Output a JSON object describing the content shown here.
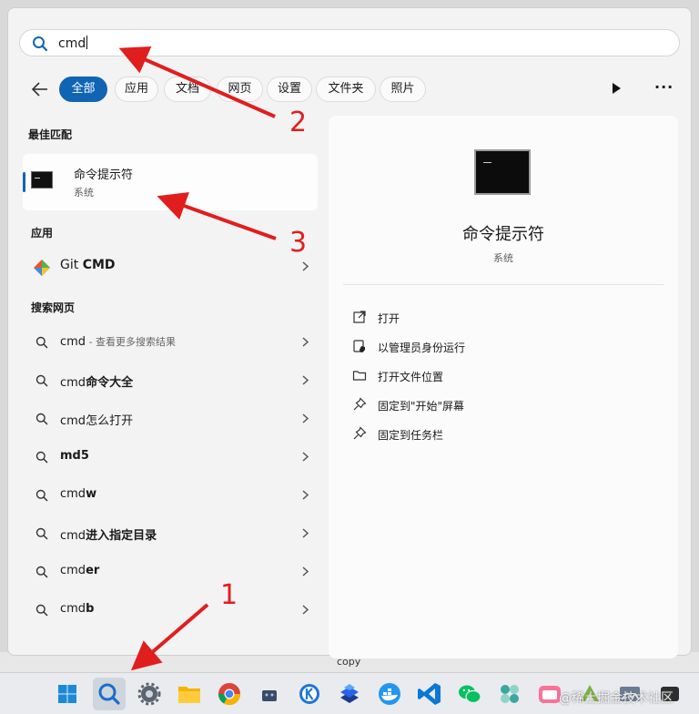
{
  "search": {
    "query": "cmd"
  },
  "tabs": [
    "全部",
    "应用",
    "文档",
    "网页",
    "设置",
    "文件夹",
    "照片"
  ],
  "more_label": "···",
  "sections": {
    "best_match": "最佳匹配",
    "apps": "应用",
    "web": "搜索网页"
  },
  "best_match": {
    "title": "命令提示符",
    "subtitle": "系统"
  },
  "apps": [
    {
      "name_plain": "Git ",
      "name_bold": "CMD"
    }
  ],
  "web_results": [
    {
      "plain": "cmd",
      "bold": "",
      "hint": " - 查看更多搜索结果"
    },
    {
      "plain": "cmd",
      "bold": "命令大全",
      "hint": ""
    },
    {
      "plain": "cmd怎么打开",
      "bold": "",
      "hint": ""
    },
    {
      "plain": "",
      "bold": "md5",
      "hint": ""
    },
    {
      "plain": "cmd",
      "bold": "w",
      "hint": ""
    },
    {
      "plain": "cmd",
      "bold": "进入指定目录",
      "hint": ""
    },
    {
      "plain": "cmd",
      "bold": "er",
      "hint": ""
    },
    {
      "plain": "cmd",
      "bold": "b",
      "hint": ""
    }
  ],
  "detail": {
    "title": "命令提示符",
    "subtitle": "系统",
    "actions": [
      {
        "icon": "open-external-icon",
        "label": "打开"
      },
      {
        "icon": "admin-shield-icon",
        "label": "以管理员身份运行"
      },
      {
        "icon": "folder-icon",
        "label": "打开文件位置"
      },
      {
        "icon": "pin-icon",
        "label": "固定到\"开始\"屏幕"
      },
      {
        "icon": "pin-icon",
        "label": "固定到任务栏"
      }
    ]
  },
  "background_text": "copy",
  "annotations": {
    "n1": "1",
    "n2": "2",
    "n3": "3"
  },
  "watermark": "@稀土掘金技术社区",
  "colors": {
    "accent": "#1064b4",
    "annotation": "#e01e1e"
  }
}
